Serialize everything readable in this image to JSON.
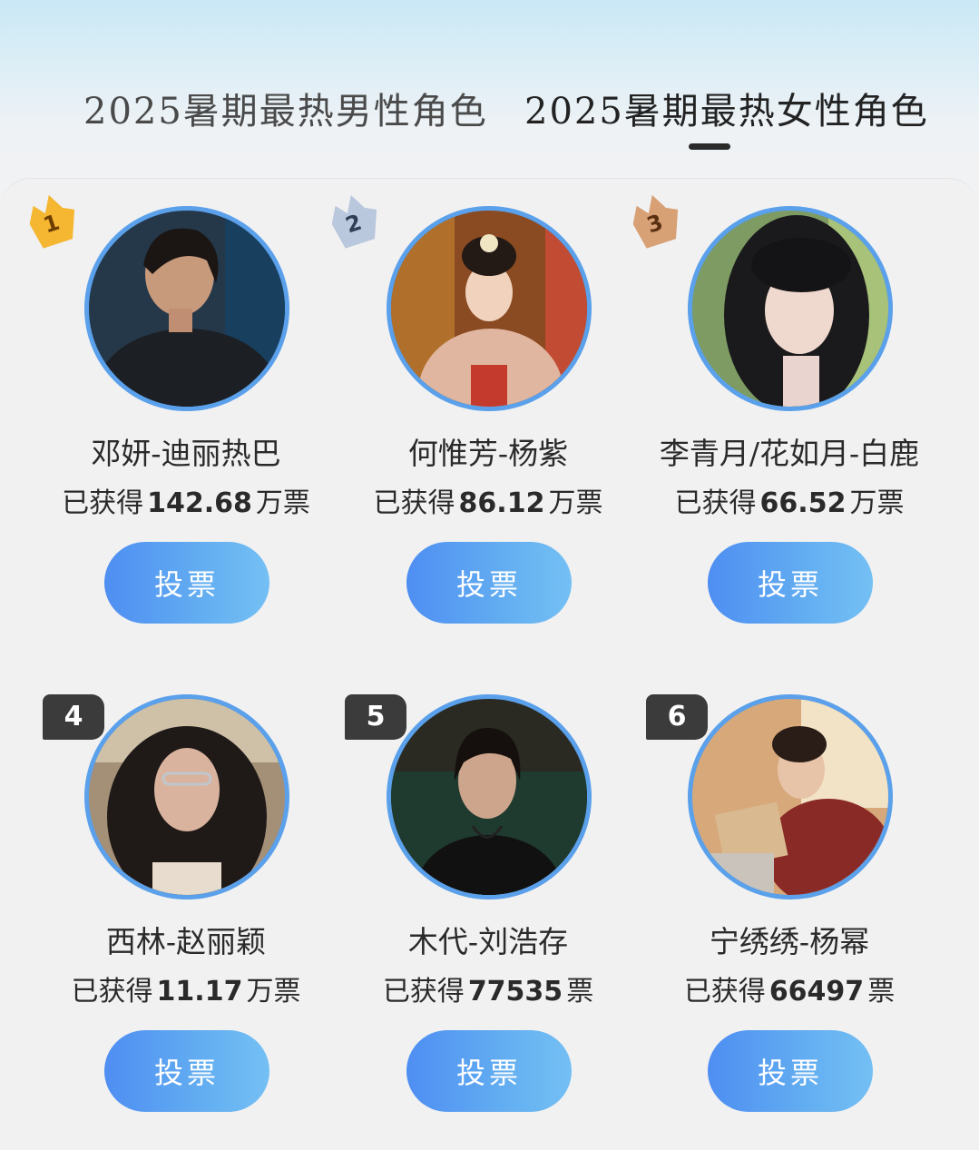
{
  "tabs": {
    "male_label": "2025暑期最热男性角色",
    "female_label": "2025暑期最热女性角色",
    "active": "female"
  },
  "colors": {
    "accent_blue": "#4e8ef2",
    "ring_blue": "#5aa0ea",
    "gold": "#f5b632",
    "silver": "#b9c8dc",
    "bronze": "#d8a075",
    "rank_box": "#3b3b3b"
  },
  "cards": [
    {
      "rank": "1",
      "name": "邓妍-迪丽热巴",
      "votes_prefix": "已获得",
      "votes_number": "142.68",
      "votes_unit": "万票",
      "button_label": "投票",
      "badge": "gold-medal-icon"
    },
    {
      "rank": "2",
      "name": "何惟芳-杨紫",
      "votes_prefix": "已获得",
      "votes_number": "86.12",
      "votes_unit": "万票",
      "button_label": "投票",
      "badge": "silver-medal-icon"
    },
    {
      "rank": "3",
      "name": "李青月/花如月-白鹿",
      "votes_prefix": "已获得",
      "votes_number": "66.52",
      "votes_unit": "万票",
      "button_label": "投票",
      "badge": "bronze-medal-icon"
    },
    {
      "rank": "4",
      "name": "西林-赵丽颖",
      "votes_prefix": "已获得",
      "votes_number": "11.17",
      "votes_unit": "万票",
      "button_label": "投票",
      "badge": "rank-box"
    },
    {
      "rank": "5",
      "name": "木代-刘浩存",
      "votes_prefix": "已获得",
      "votes_number": "77535",
      "votes_unit": "票",
      "button_label": "投票",
      "badge": "rank-box"
    },
    {
      "rank": "6",
      "name": "宁绣绣-杨幂",
      "votes_prefix": "已获得",
      "votes_number": "66497",
      "votes_unit": "票",
      "button_label": "投票",
      "badge": "rank-box"
    }
  ]
}
